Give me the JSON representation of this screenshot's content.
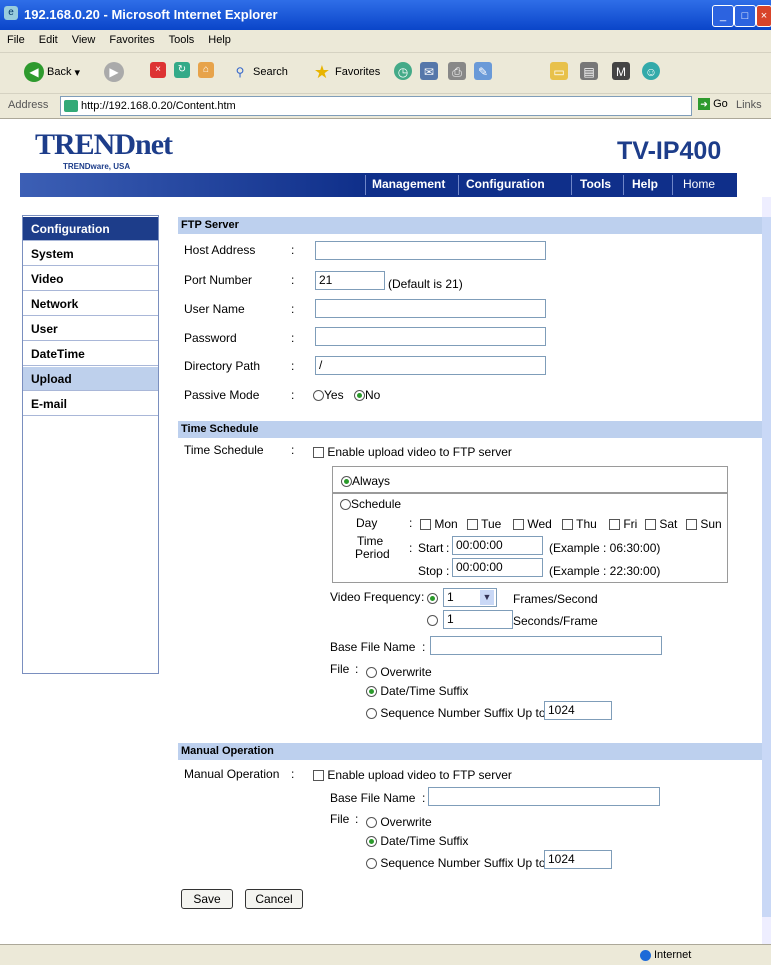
{
  "window": {
    "title": "192.168.0.20 - Microsoft Internet Explorer"
  },
  "menu": [
    "File",
    "Edit",
    "View",
    "Favorites",
    "Tools",
    "Help"
  ],
  "toolbar": {
    "back": "Back",
    "search": "Search",
    "favorites": "Favorites"
  },
  "address": {
    "label": "Address",
    "url": "http://192.168.0.20/Content.htm",
    "go": "Go",
    "links": "Links"
  },
  "brand": {
    "logo": "TRENDnet",
    "tagline": "TRENDware, USA",
    "model": "TV-IP400"
  },
  "nav": [
    "Management",
    "Configuration",
    "Tools",
    "Help",
    "Home"
  ],
  "sidebar": {
    "header": "Configuration",
    "items": [
      "System",
      "Video",
      "Network",
      "User",
      "DateTime",
      "Upload",
      "E-mail"
    ],
    "active": "Upload"
  },
  "ftp": {
    "title": "FTP Server",
    "host_label": "Host Address",
    "port_label": "Port Number",
    "port_value": "21",
    "port_hint": "(Default is 21)",
    "user_label": "User Name",
    "password_label": "Password",
    "dir_label": "Directory Path",
    "dir_value": "/",
    "passive_label": "Passive Mode",
    "yes": "Yes",
    "no": "No"
  },
  "schedule": {
    "title": "Time Schedule",
    "label": "Time Schedule",
    "enable": "Enable upload video to FTP server",
    "always": "Always",
    "schedule": "Schedule",
    "day": "Day",
    "days": [
      "Mon",
      "Tue",
      "Wed",
      "Thu",
      "Fri",
      "Sat",
      "Sun"
    ],
    "time": "Time",
    "period": "Period",
    "start": "Start",
    "start_value": "00:00:00",
    "start_example": "(Example : 06:30:00)",
    "stop": "Stop",
    "stop_value": "00:00:00",
    "stop_example": "(Example : 22:30:00)",
    "freq_label": "Video Frequency",
    "freq_value": "1",
    "frames": "Frames/Second",
    "spf_value": "1",
    "seconds": "Seconds/Frame",
    "base_label": "Base File Name",
    "file_label": "File",
    "overwrite": "Overwrite",
    "datetime": "Date/Time Suffix",
    "sequence": "Sequence Number Suffix Up to",
    "sequence_value": "1024"
  },
  "manual": {
    "title": "Manual Operation",
    "label": "Manual Operation",
    "enable": "Enable upload video to FTP server",
    "base_label": "Base File Name",
    "file_label": "File",
    "overwrite": "Overwrite",
    "datetime": "Date/Time Suffix",
    "sequence": "Sequence Number Suffix Up to",
    "sequence_value": "1024"
  },
  "buttons": {
    "save": "Save",
    "cancel": "Cancel"
  },
  "status": {
    "zone": "Internet"
  }
}
